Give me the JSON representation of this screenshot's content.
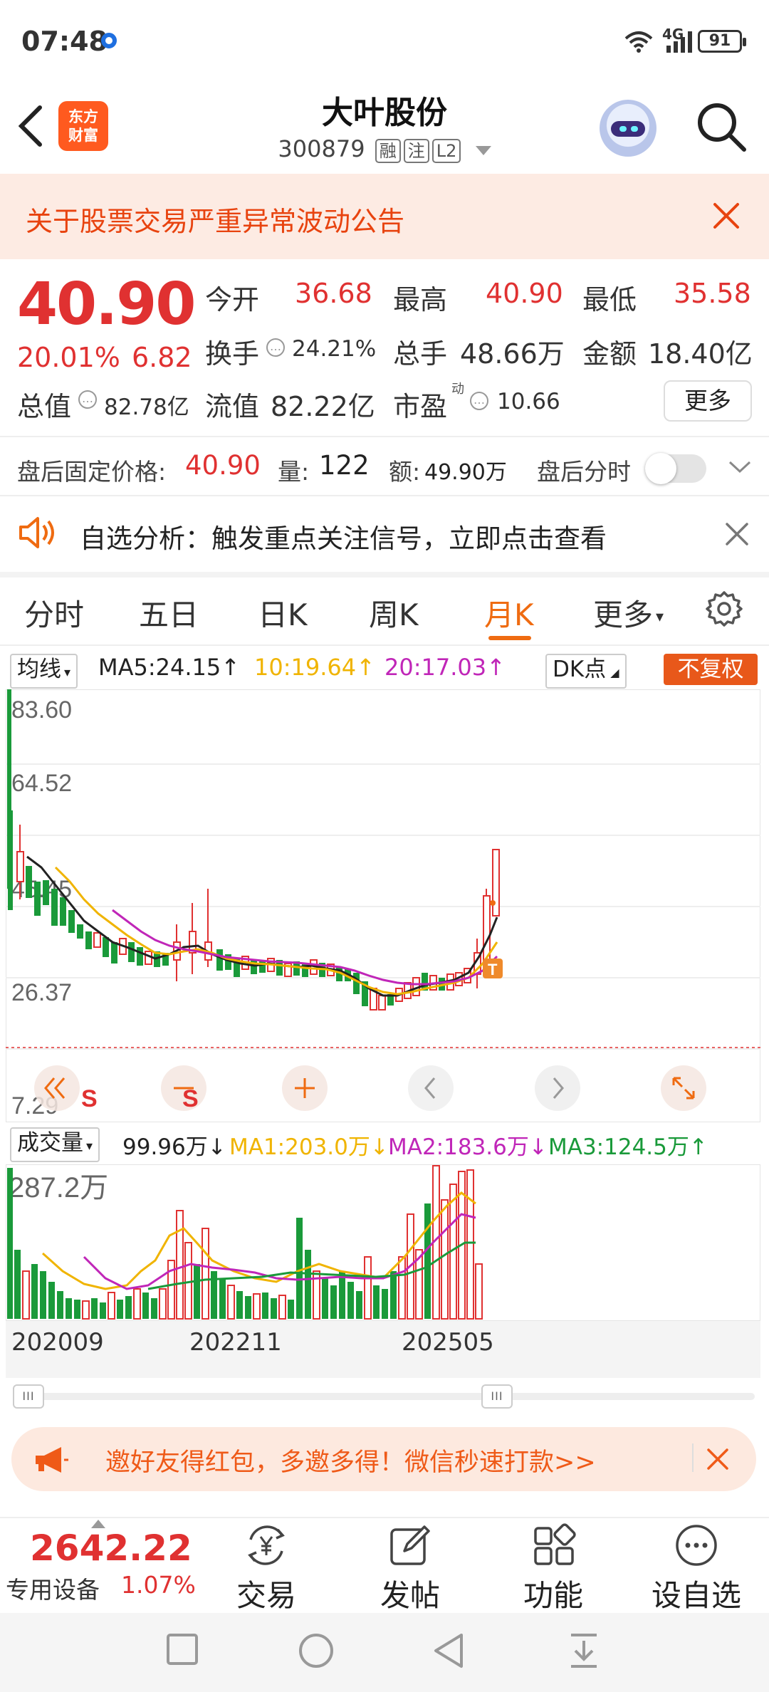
{
  "status": {
    "time": "07:48",
    "network": "4G",
    "battery": "91"
  },
  "header": {
    "logo_line1": "东方",
    "logo_line2": "财富",
    "stock_name": "大叶股份",
    "stock_code": "300879",
    "tags": [
      "融",
      "注",
      "L2"
    ]
  },
  "notice": {
    "text": "关于股票交易严重异常波动公告"
  },
  "quote": {
    "price": "40.90",
    "change_pct": "20.01%",
    "change_amt": "6.82",
    "open_label": "今开",
    "open": "36.68",
    "high_label": "最高",
    "high": "40.90",
    "low_label": "最低",
    "low": "35.58",
    "turnover_label": "换手",
    "turnover": "24.21%",
    "volume_label": "总手",
    "volume": "48.66万",
    "amount_label": "金额",
    "amount": "18.40亿",
    "mktcap_label": "总值",
    "mktcap": "82.78亿",
    "float_label": "流值",
    "float_cap": "82.22亿",
    "pe_label": "市盈",
    "pe_sup": "动",
    "pe": "10.66",
    "more": "更多"
  },
  "after_hours": {
    "label": "盘后固定价格:",
    "price": "40.90",
    "vol_label": "量:",
    "vol": "122",
    "amt_label": "额:",
    "amt": "49.90万",
    "timeshare": "盘后分时"
  },
  "analysis": {
    "text": "自选分析：触发重点关注信号，立即点击查看"
  },
  "tabs": [
    "分时",
    "五日",
    "日K",
    "周K",
    "月K",
    "更多"
  ],
  "active_tab": "月K",
  "ma": {
    "selector": "均线",
    "ma5": "MA5:24.15↑",
    "ma10": "10:19.64↑",
    "ma20": "20:17.03↑",
    "dk": "DK点",
    "adjust": "不复权",
    "colors": {
      "ma5": "#222222",
      "ma10": "#f0b400",
      "ma20": "#c026b8"
    }
  },
  "kline": {
    "y_labels": [
      "83.60",
      "64.52",
      "45.45",
      "26.37",
      "7.29"
    ],
    "markers": {
      "s": "S",
      "t": "T"
    }
  },
  "volume": {
    "selector": "成交量",
    "value": "99.96万↓",
    "ma1": "MA1:203.0万↓",
    "ma2": "MA2:183.6万↓",
    "ma3": "MA3:124.5万↑",
    "y_label": "287.2万",
    "colors": {
      "ma1": "#f0b400",
      "ma2": "#c026b8",
      "ma3": "#1a9a3a"
    }
  },
  "x_labels": [
    "202009",
    "202211",
    "202505"
  ],
  "promo": {
    "text": "邀好友得红包，多邀多得！微信秒速打款>>"
  },
  "bottom": {
    "index_value": "2642.22",
    "index_name": "专用设备",
    "index_change": "1.07%",
    "items": [
      {
        "icon": "yuan-exchange-icon",
        "label": "交易"
      },
      {
        "icon": "compose-icon",
        "label": "发帖"
      },
      {
        "icon": "grid-icon",
        "label": "功能"
      },
      {
        "icon": "more-circle-icon",
        "label": "设自选"
      }
    ]
  },
  "colors": {
    "up": "#e03131",
    "down": "#1a9a3a",
    "accent": "#ef6b11"
  }
}
